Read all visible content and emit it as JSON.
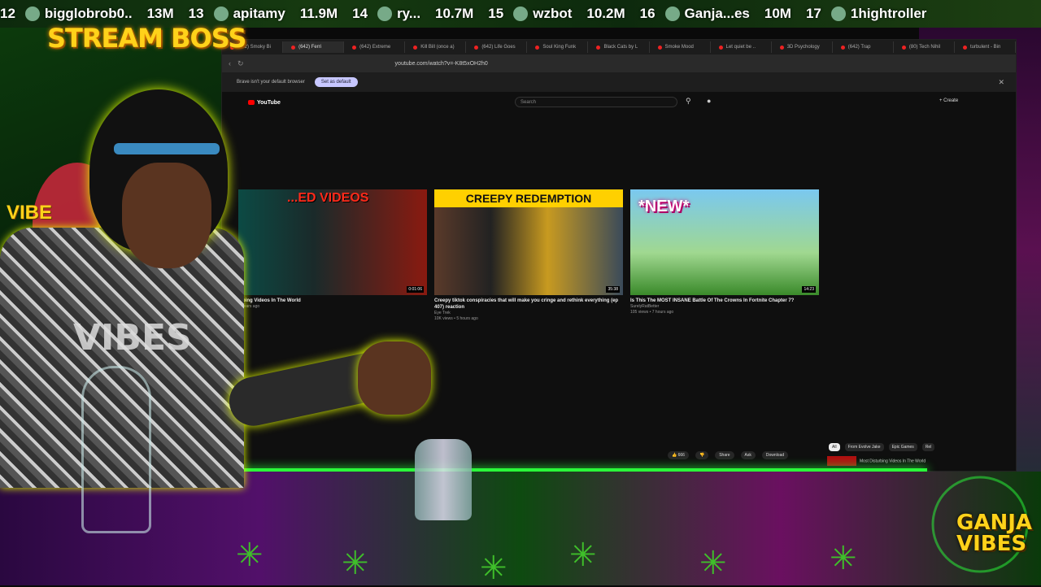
{
  "ticker": [
    {
      "rank": "12",
      "name": "bigglobrob0..",
      "value": "13M"
    },
    {
      "rank": "13",
      "name": "apitamy",
      "value": "11.9M"
    },
    {
      "rank": "14",
      "name": "ry...",
      "value": "10.7M"
    },
    {
      "rank": "15",
      "name": "wzbot",
      "value": "10.2M"
    },
    {
      "rank": "16",
      "name": "Ganja...es",
      "value": "10M"
    },
    {
      "rank": "17",
      "name": "1hightroller",
      "value": ""
    }
  ],
  "overlay": {
    "stream_boss": "STREAM BOSS",
    "vibe_left": "VIBE",
    "shirt_text": "VIBES",
    "ganja_line1": "GANJA",
    "ganja_line2": "VIBES"
  },
  "browser": {
    "tabs": [
      "(642) Smoky Bi",
      "(642) Ferri",
      "(642) Extreme",
      "Kill Bill (once a)",
      "(642) Life Goes",
      "Soul King Funk",
      "Black Cats by L",
      "Smoke Mood",
      "Let quiet be ..",
      "3D Psychology",
      "(642) Trap",
      "(80) Tech Nihil",
      "turbulent - Bin"
    ],
    "url": "youtube.com/watch?v=-K8t5xOH2h0",
    "infobar_text": "Brave isn't your default browser",
    "infobar_button": "Set as default",
    "yt_logo": "YouTube",
    "search_placeholder": "Search",
    "create_label": "+ Create"
  },
  "videos": [
    {
      "overlay": "...ED VIDEOS",
      "title": "...bing Videos In The World",
      "channel": "",
      "meta": "...years ago",
      "duration": "0:01:06"
    },
    {
      "banner": "CREEPY REDEMPTION",
      "title": "Creepy tiktok conspiracies that will make you cringe and rethink everything (ep 407) reaction",
      "channel": "Eye Trek",
      "meta": "10K views • 5 hours ago",
      "duration": "35:38"
    },
    {
      "tag": "*NEW*",
      "title": "Is This The MOST INSANE Battle Of The Crowns In Fortnite Chapter 7?",
      "channel": "SurelyRatBetter",
      "meta": "105 views • 7 hours ago",
      "duration": "14:23"
    }
  ],
  "actions": {
    "likes": "666",
    "share": "Share",
    "ask": "Ask",
    "download": "Download"
  },
  "chips": [
    "All",
    "From Evolve Jake",
    "Epic Games",
    "Rel"
  ],
  "next_video": "Most Disturbing Videos In The World",
  "colors": {
    "ticker_bg": "#0d2a0d",
    "boss_gold": "#ffd21a",
    "glow_green": "#2aff3a"
  }
}
